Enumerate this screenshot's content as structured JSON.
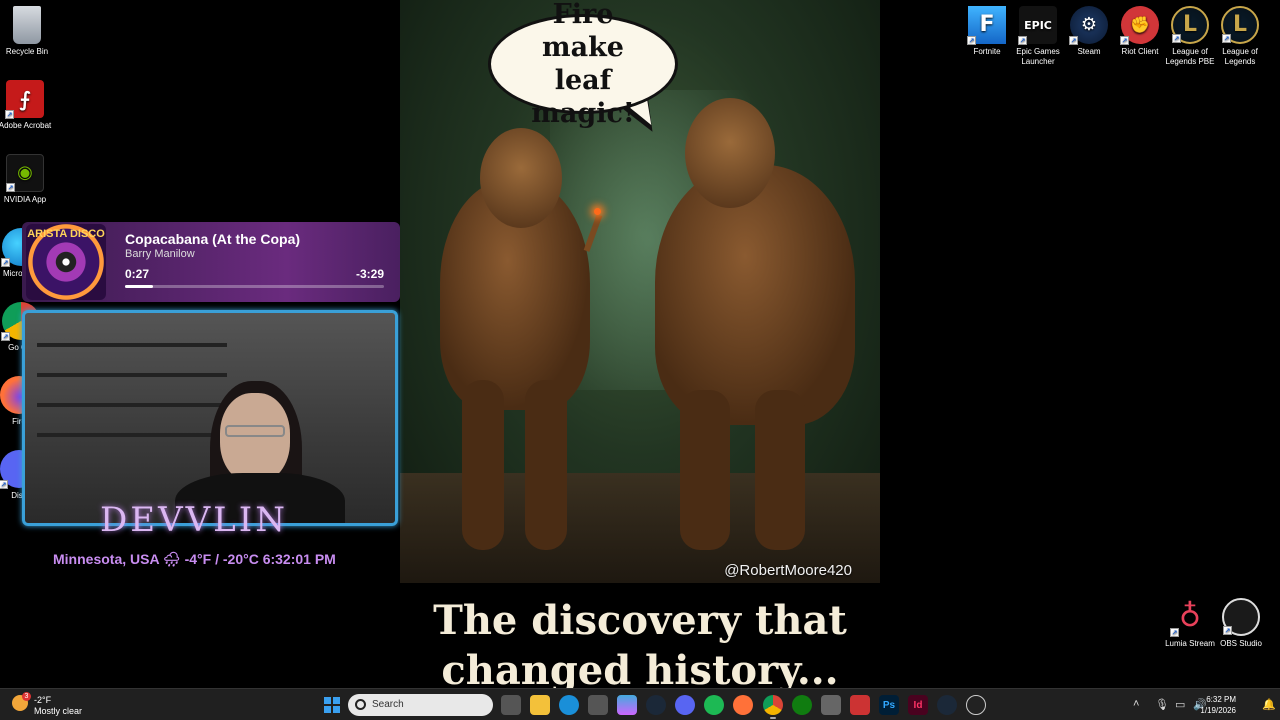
{
  "desktop_left": [
    {
      "label": "Recycle Bin",
      "icon": "recycle-bin-icon"
    },
    {
      "label": "Adobe Acrobat",
      "icon": "adobe-acrobat-icon"
    },
    {
      "label": "NVIDIA App",
      "icon": "nvidia-app-icon"
    },
    {
      "label": "Micro Edg",
      "icon": "edge-icon"
    },
    {
      "label": "Go Chr",
      "icon": "chrome-icon"
    },
    {
      "label": "Fire",
      "icon": "firefox-icon"
    },
    {
      "label": "Disc",
      "icon": "discord-icon"
    }
  ],
  "desktop_right": [
    {
      "label": "Fortnite",
      "icon": "fortnite-icon",
      "glyph": "F"
    },
    {
      "label": "Epic Games Launcher",
      "icon": "epic-games-icon",
      "glyph": "EPIC"
    },
    {
      "label": "Steam",
      "icon": "steam-icon",
      "glyph": "⚙"
    },
    {
      "label": "Riot Client",
      "icon": "riot-client-icon",
      "glyph": "✊"
    },
    {
      "label": "League of Legends PBE",
      "icon": "league-pbe-icon",
      "glyph": "L"
    },
    {
      "label": "League of Legends",
      "icon": "league-icon",
      "glyph": "L"
    }
  ],
  "desktop_bottom_right": [
    {
      "label": "Lumia Stream",
      "icon": "lumia-stream-icon"
    },
    {
      "label": "OBS Studio",
      "icon": "obs-studio-icon"
    }
  ],
  "artwork": {
    "speech": "Fire make leaf magic!",
    "watermark": "@RobertMoore420",
    "caption": "The discovery that changed history..."
  },
  "music": {
    "album_text": "ARISTA DISCO",
    "track": "Copacabana (At the Copa)",
    "artist": "Barry Manilow",
    "elapsed": "0:27",
    "remaining": "-3:29",
    "progress": 0.11
  },
  "overlay": {
    "streamer": "DEVVLIN",
    "location": "Minnesota, USA 🌧 -4°F / -20°C 6:32:01 PM"
  },
  "taskbar": {
    "weather_temp": "-2°F",
    "weather_desc": "Mostly clear",
    "weather_badge": "3",
    "search_placeholder": "Search",
    "time": "6:32 PM",
    "date": "1/19/2026"
  },
  "colors": {
    "accent_webcam": "#3aa0d8",
    "taskbar": "#202020",
    "music_bg": "#6a2b7e"
  }
}
